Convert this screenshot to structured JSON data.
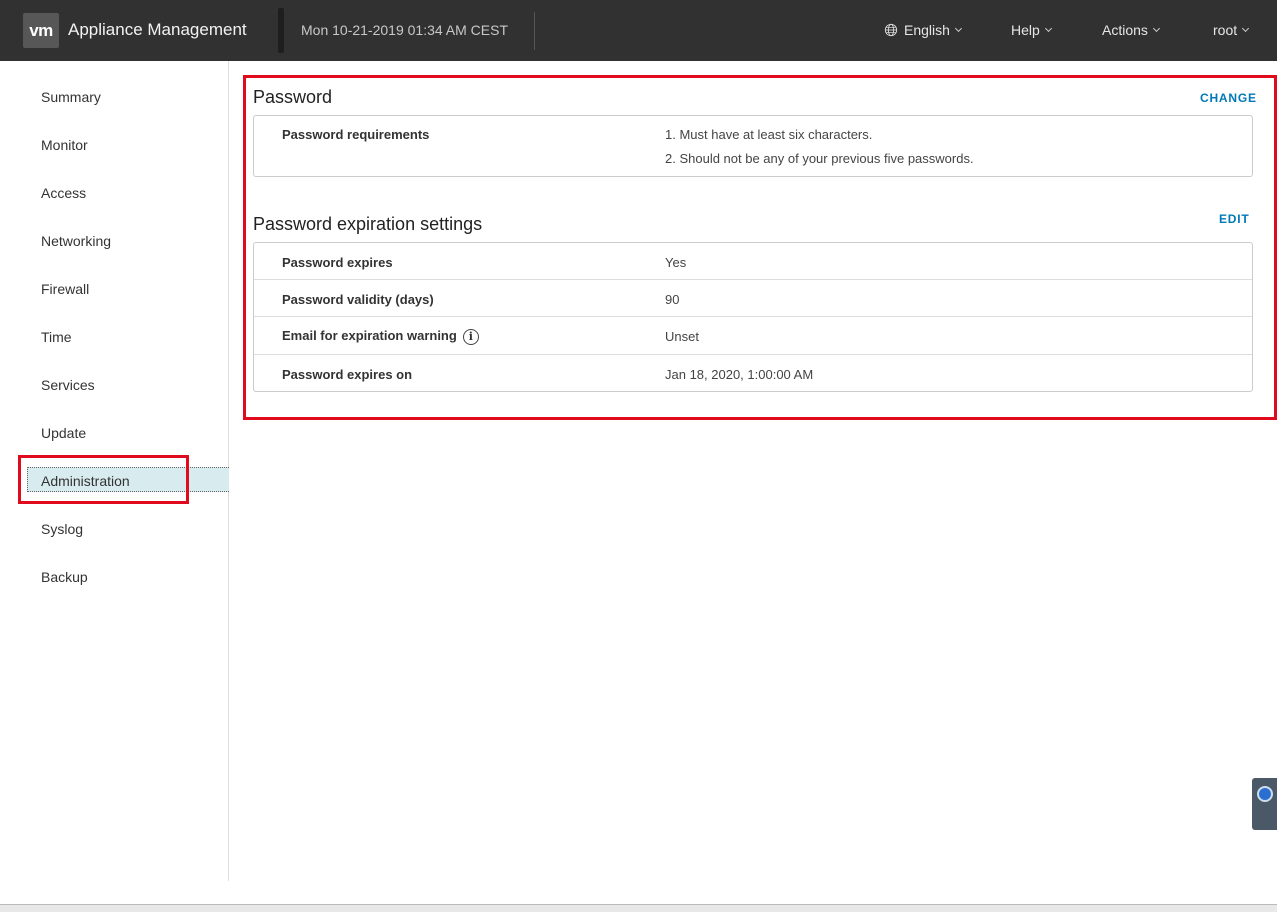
{
  "header": {
    "logo": "vm",
    "app_title": "Appliance Management",
    "datetime": "Mon 10-21-2019 01:34 AM CEST",
    "language": "English",
    "help": "Help",
    "actions": "Actions",
    "user": "root"
  },
  "sidebar": {
    "items": [
      {
        "label": "Summary"
      },
      {
        "label": "Monitor"
      },
      {
        "label": "Access"
      },
      {
        "label": "Networking"
      },
      {
        "label": "Firewall"
      },
      {
        "label": "Time"
      },
      {
        "label": "Services"
      },
      {
        "label": "Update"
      },
      {
        "label": "Administration"
      },
      {
        "label": "Syslog"
      },
      {
        "label": "Backup"
      }
    ],
    "active": "Administration"
  },
  "password": {
    "title": "Password",
    "action": "CHANGE",
    "requirements_label": "Password requirements",
    "requirements": [
      "1. Must have at least six characters.",
      "2. Should not be any of your previous five passwords."
    ]
  },
  "expiration": {
    "title": "Password expiration settings",
    "action": "EDIT",
    "rows": [
      {
        "label": "Password expires",
        "value": "Yes"
      },
      {
        "label": "Password validity (days)",
        "value": "90"
      },
      {
        "label": "Email for expiration warning",
        "value": "Unset"
      },
      {
        "label": "Password expires on",
        "value": "Jan 18, 2020, 1:00:00 AM"
      }
    ]
  },
  "colors": {
    "header_bg": "#313131",
    "accent_link": "#0079b8",
    "highlight_box": "#e00b1c",
    "active_nav_bg": "#d8ebef"
  }
}
